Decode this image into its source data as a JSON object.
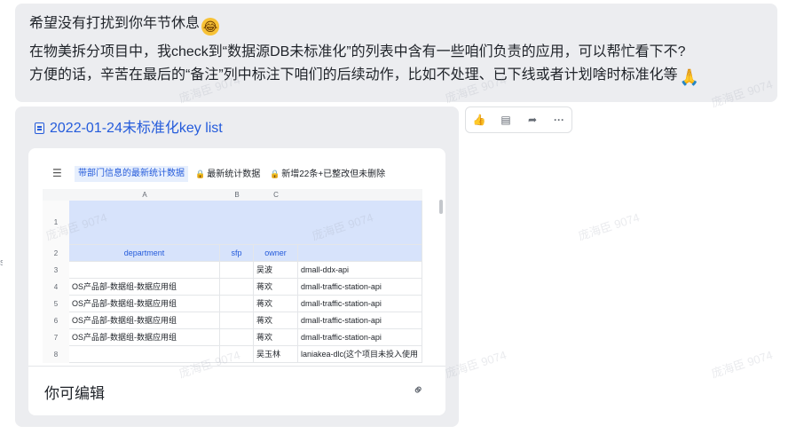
{
  "message": {
    "line1": "希望没有打扰到你年节休息",
    "line2": "在物美拆分项目中，我check到“数据源DB未标准化”的列表中含有一些咱们负责的应用，可以帮忙看下不?",
    "line3": "方便的话，辛苦在最后的“备注”列中标注下咱们的后续动作，比如不处理、已下线或者计划啥时标准化等",
    "emoji1": "laugh-cry-emoji",
    "emoji2": "pray-emoji"
  },
  "doc": {
    "title": "2022-01-24未标准化key list",
    "icon": "doc-icon"
  },
  "sheet": {
    "tabs": [
      {
        "label": "带部门信息的最新统计数据",
        "active": true
      },
      {
        "label": "最新统计数据",
        "active": false
      },
      {
        "label": "新增22条+已整改但未删除",
        "active": false
      }
    ],
    "columns": [
      "A",
      "B",
      "C"
    ],
    "row_numbers": [
      "1",
      "2",
      "3",
      "4",
      "5",
      "6",
      "7",
      "8"
    ],
    "headers": {
      "department": "department",
      "sfp": "sfp",
      "owner": "owner"
    },
    "rows": [
      {
        "department": "",
        "sfp": "",
        "owner": "吴波",
        "app": "dmall-ddx-api"
      },
      {
        "department": "OS产品部-数据组-数据应用组",
        "sfp": "",
        "owner": "蒋欢",
        "app": "dmall-traffic-station-api"
      },
      {
        "department": "OS产品部-数据组-数据应用组",
        "sfp": "",
        "owner": "蒋欢",
        "app": "dmall-traffic-station-api"
      },
      {
        "department": "OS产品部-数据组-数据应用组",
        "sfp": "",
        "owner": "蒋欢",
        "app": "dmall-traffic-station-api"
      },
      {
        "department": "OS产品部-数据组-数据应用组",
        "sfp": "",
        "owner": "蒋欢",
        "app": "dmall-traffic-station-api"
      },
      {
        "department": "",
        "sfp": "",
        "owner": "吴玉林",
        "app": "laniakea-dlc(这个项目未投入使用"
      }
    ],
    "permission_text": "你可编辑"
  },
  "toolbar": {
    "buttons": [
      "thumbs-up-icon",
      "comment-icon",
      "forward-icon",
      "more-icon"
    ]
  },
  "watermark": "庞海臣 9074"
}
